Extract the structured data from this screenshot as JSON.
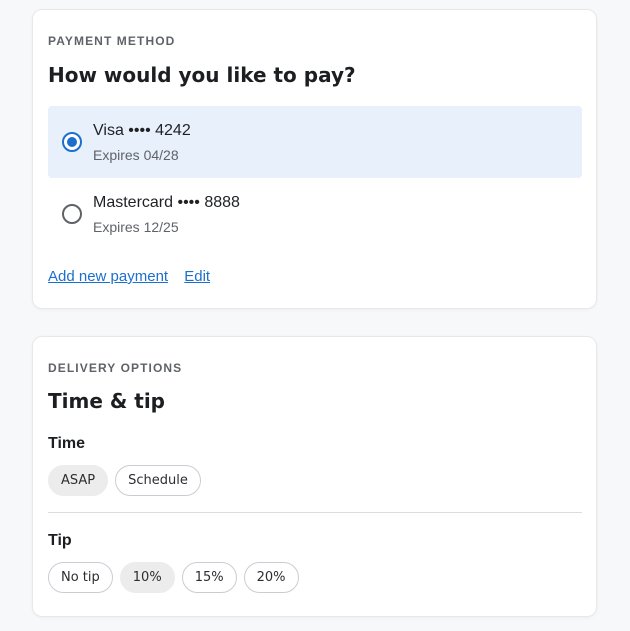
{
  "payment": {
    "eyebrow": "PAYMENT METHOD",
    "heading": "How would you like to pay?",
    "options": [
      {
        "name": "Visa •••• 4242",
        "expires": "Expires 04/28",
        "selected": true
      },
      {
        "name": "Mastercard •••• 8888",
        "expires": "Expires 12/25",
        "selected": false
      }
    ],
    "add_link": "Add new payment",
    "edit_link": "Edit"
  },
  "delivery": {
    "eyebrow": "DELIVERY OPTIONS",
    "heading": "Time & tip",
    "time_label": "Time",
    "time_options": [
      {
        "label": "ASAP",
        "selected": true
      },
      {
        "label": "Schedule",
        "selected": false
      }
    ],
    "tip_label": "Tip",
    "tip_options": [
      {
        "label": "No tip",
        "selected": false
      },
      {
        "label": "10%",
        "selected": true
      },
      {
        "label": "15%",
        "selected": false
      },
      {
        "label": "20%",
        "selected": false
      }
    ]
  },
  "colors": {
    "accent": "#1d6fce",
    "selected_bg": "#e7f0fb",
    "chip_selected_bg": "#ececec"
  }
}
